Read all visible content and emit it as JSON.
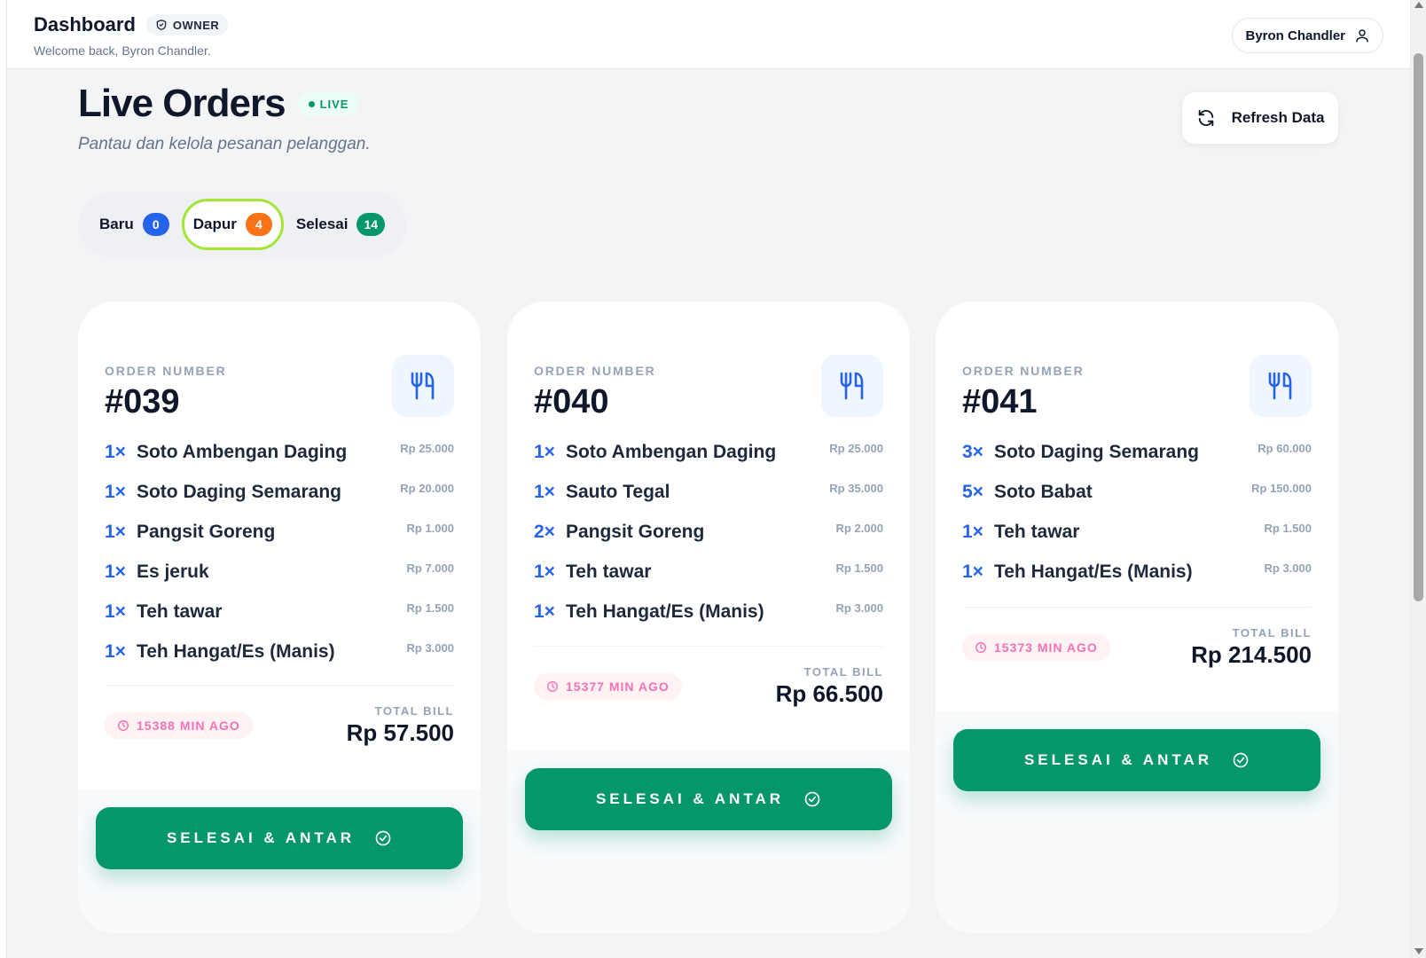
{
  "header": {
    "title": "Dashboard",
    "role_badge": "OWNER",
    "welcome": "Welcome back, Byron Chandler.",
    "user_name": "Byron Chandler"
  },
  "page": {
    "title": "Live Orders",
    "live_badge": "LIVE",
    "subtitle": "Pantau dan kelola pesanan pelanggan.",
    "refresh_label": "Refresh Data"
  },
  "tabs": [
    {
      "label": "Baru",
      "count": "0",
      "color": "#2563eb",
      "active": false
    },
    {
      "label": "Dapur",
      "count": "4",
      "color": "#f97316",
      "active": true
    },
    {
      "label": "Selesai",
      "count": "14",
      "color": "#059669",
      "active": false
    }
  ],
  "orders": [
    {
      "label": "ORDER NUMBER",
      "number": "#039",
      "items": [
        {
          "qty": "1×",
          "name": "Soto Ambengan Daging",
          "price": "Rp 25.000"
        },
        {
          "qty": "1×",
          "name": "Soto Daging Semarang",
          "price": "Rp 20.000"
        },
        {
          "qty": "1×",
          "name": "Pangsit Goreng",
          "price": "Rp 1.000"
        },
        {
          "qty": "1×",
          "name": "Es jeruk",
          "price": "Rp 7.000"
        },
        {
          "qty": "1×",
          "name": "Teh tawar",
          "price": "Rp 1.500"
        },
        {
          "qty": "1×",
          "name": "Teh Hangat/Es (Manis)",
          "price": "Rp 3.000"
        }
      ],
      "ago": "15388 MIN AGO",
      "total_label": "TOTAL BILL",
      "total": "Rp 57.500",
      "action": "SELESAI & ANTAR"
    },
    {
      "label": "ORDER NUMBER",
      "number": "#040",
      "items": [
        {
          "qty": "1×",
          "name": "Soto Ambengan Daging",
          "price": "Rp 25.000"
        },
        {
          "qty": "1×",
          "name": "Sauto Tegal",
          "price": "Rp 35.000"
        },
        {
          "qty": "2×",
          "name": "Pangsit Goreng",
          "price": "Rp 2.000"
        },
        {
          "qty": "1×",
          "name": "Teh tawar",
          "price": "Rp 1.500"
        },
        {
          "qty": "1×",
          "name": "Teh Hangat/Es (Manis)",
          "price": "Rp 3.000"
        }
      ],
      "ago": "15377 MIN AGO",
      "total_label": "TOTAL BILL",
      "total": "Rp 66.500",
      "action": "SELESAI & ANTAR"
    },
    {
      "label": "ORDER NUMBER",
      "number": "#041",
      "items": [
        {
          "qty": "3×",
          "name": "Soto Daging Semarang",
          "price": "Rp 60.000"
        },
        {
          "qty": "5×",
          "name": "Soto Babat",
          "price": "Rp 150.000"
        },
        {
          "qty": "1×",
          "name": "Teh tawar",
          "price": "Rp 1.500"
        },
        {
          "qty": "1×",
          "name": "Teh Hangat/Es (Manis)",
          "price": "Rp 3.000"
        }
      ],
      "ago": "15373 MIN AGO",
      "total_label": "TOTAL BILL",
      "total": "Rp 214.500",
      "action": "SELESAI & ANTAR"
    }
  ],
  "icons": {
    "role": "shield-icon",
    "user": "user-icon",
    "refresh": "refresh-icon",
    "food": "utensils-icon",
    "clock": "clock-icon",
    "check": "check-circle-icon"
  },
  "colors": {
    "accent_blue": "#2563eb",
    "success_green": "#059669",
    "kitchen_orange": "#f97316",
    "active_ring": "#a3e635",
    "ago_pink": "#f472b6"
  }
}
